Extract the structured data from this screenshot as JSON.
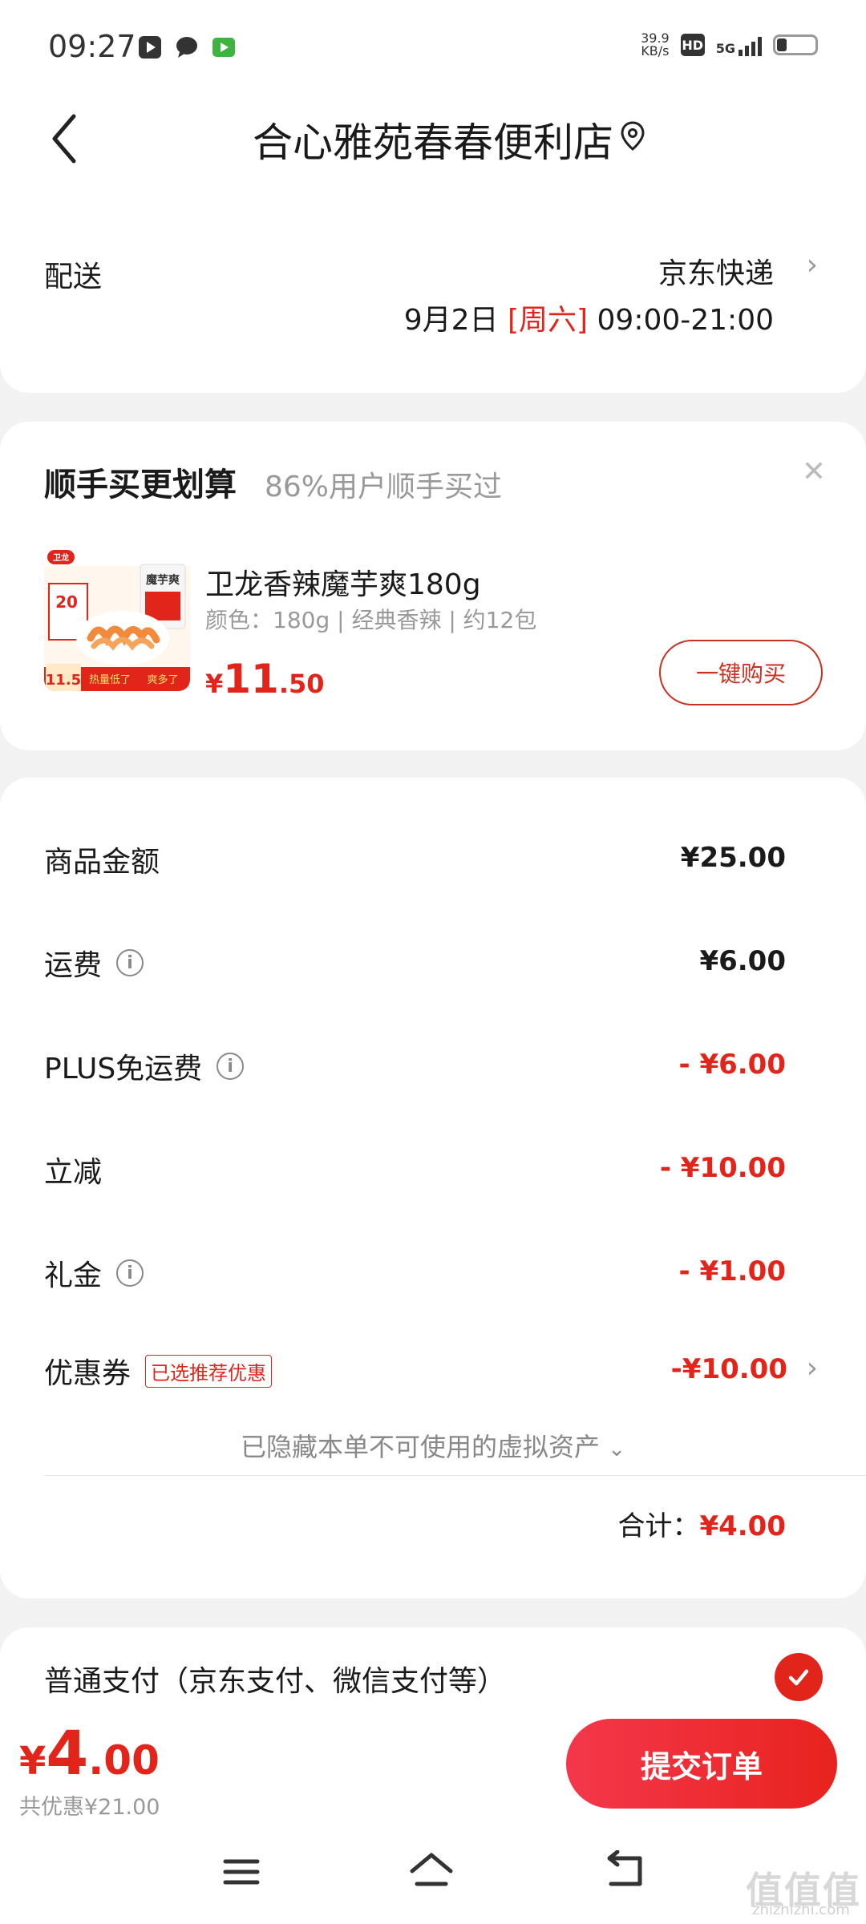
{
  "status_bar": {
    "time": "09:27",
    "net_speed_value": "39.9",
    "net_speed_unit": "KB/s",
    "hd": "HD",
    "network": "5G",
    "icons_left": [
      "video-app-icon",
      "message-icon",
      "iqiyi-icon"
    ]
  },
  "header": {
    "title": "合心雅苑春春便利店"
  },
  "delivery": {
    "label": "配送",
    "method": "京东快递",
    "date": "9月2日",
    "weekday": "[周六]",
    "time": "09:00-21:00"
  },
  "upsell": {
    "title": "顺手买更划算",
    "subtitle": "86%用户顺手买过",
    "product_name": "卫龙香辣魔芋爽180g",
    "product_spec": "颜色：180g | 经典香辣 | 约12包",
    "price_symbol": "¥",
    "price_int": "11",
    "price_dec": ".50",
    "buy_label": "一键购买",
    "img_badge_top": "20",
    "img_badge_price": "11.5",
    "img_slogan_a": "热量低了",
    "img_slogan_b": "爽多了",
    "img_brand": "卫龙",
    "img_pack": "魔芋爽"
  },
  "fees": {
    "goods_label": "商品金额",
    "goods_value": "¥25.00",
    "shipping_label": "运费",
    "shipping_value": "¥6.00",
    "plus_label": "PLUS免运费",
    "plus_value": "- ¥6.00",
    "discount_label": "立减",
    "discount_value": "- ¥10.00",
    "gift_label": "礼金",
    "gift_value": "- ¥1.00",
    "coupon_label": "优惠券",
    "coupon_tag": "已选推荐优惠",
    "coupon_value": "-¥10.00",
    "hidden_assets": "已隐藏本单不可使用的虚拟资产",
    "total_label": "合计：",
    "total_value": "¥4.00"
  },
  "payment": {
    "label": "普通支付（京东支付、微信支付等）"
  },
  "bottom": {
    "price_symbol": "¥",
    "price_int": "4",
    "price_dec": ".00",
    "saved": "共优惠¥21.00",
    "submit": "提交订单"
  },
  "watermark": {
    "main": "值值值",
    "sub": "zhizhizhi.com"
  },
  "colors": {
    "accent": "#e1251b",
    "button_outline": "#c8301f",
    "background": "#f2f2f2"
  }
}
